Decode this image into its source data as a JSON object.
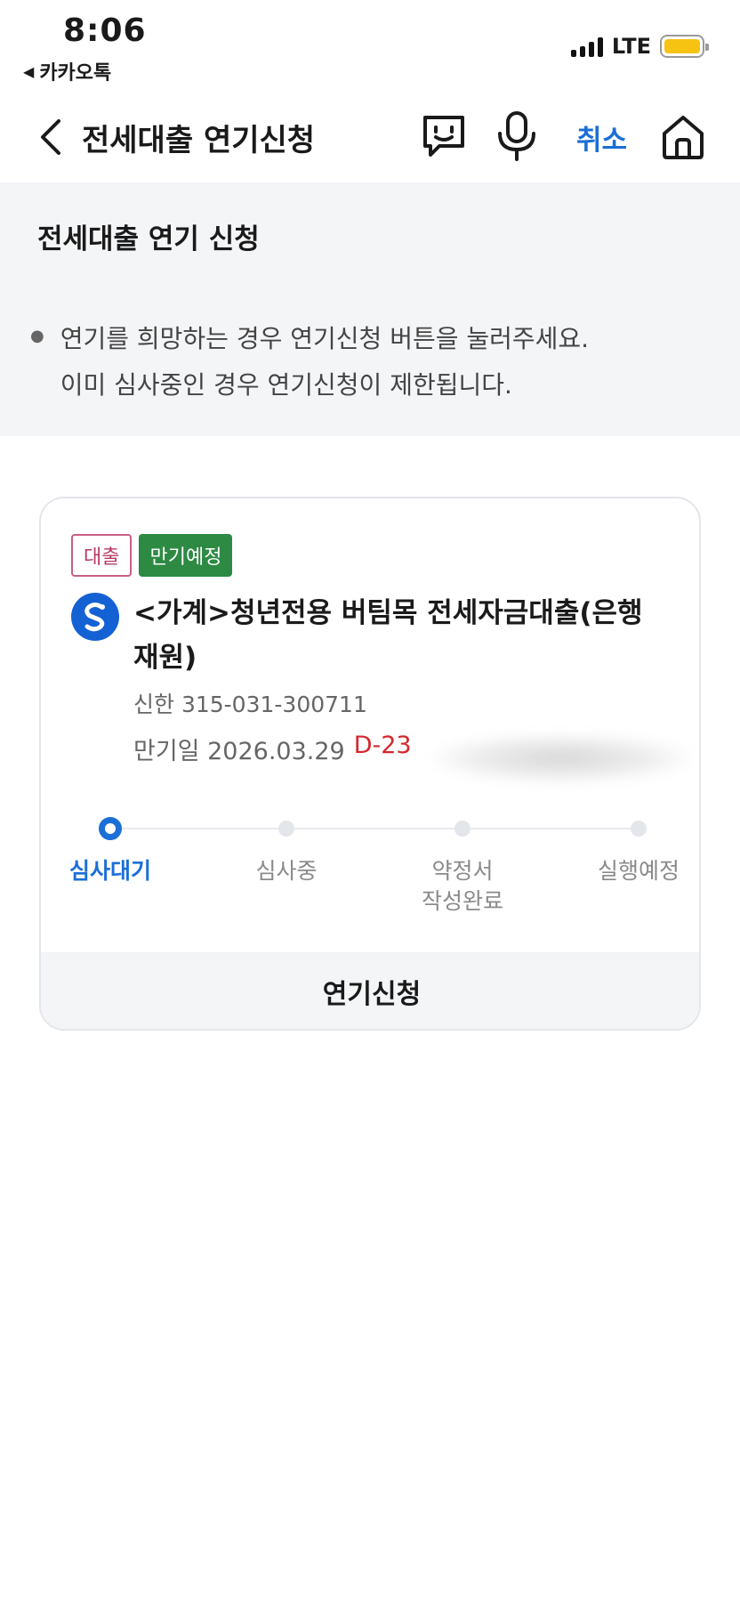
{
  "status_bar": {
    "time": "8:06",
    "back_app_label": "카카오톡",
    "network": "LTE",
    "battery_color": "#f6c313"
  },
  "nav": {
    "back_icon": "chevron-left-icon",
    "title": "전세대출 연기신청",
    "chat_icon": "chatbot-icon",
    "mic_icon": "microphone-icon",
    "cancel_label": "취소",
    "home_icon": "home-icon"
  },
  "info": {
    "title": "전세대출 연기 신청",
    "notice_line1": "연기를 희망하는 경우 연기신청 버튼을 눌러주세요.",
    "notice_line2": "이미 심사중인 경우 연기신청이 제한됩니다."
  },
  "loan": {
    "badge_loan": "대출",
    "badge_status": "만기예정",
    "bank_icon": "shinhan-bank-logo",
    "product_name": "<가계>청년전용 버팀목 전세자금대출(은행재원)",
    "account": "신한 315-031-300711",
    "maturity_label": "만기일 2026.03.29",
    "dday": "D-23",
    "steps": [
      "심사대기",
      "심사중",
      "약정서\n작성완료",
      "실행예정"
    ],
    "active_step": 0,
    "action_label": "연기신청"
  },
  "colors": {
    "accent_blue": "#1b6fd6",
    "dday_red": "#d4272d",
    "badge_green": "#2d8a43",
    "badge_pink": "#c85f86",
    "section_gray": "#f4f5f7"
  }
}
